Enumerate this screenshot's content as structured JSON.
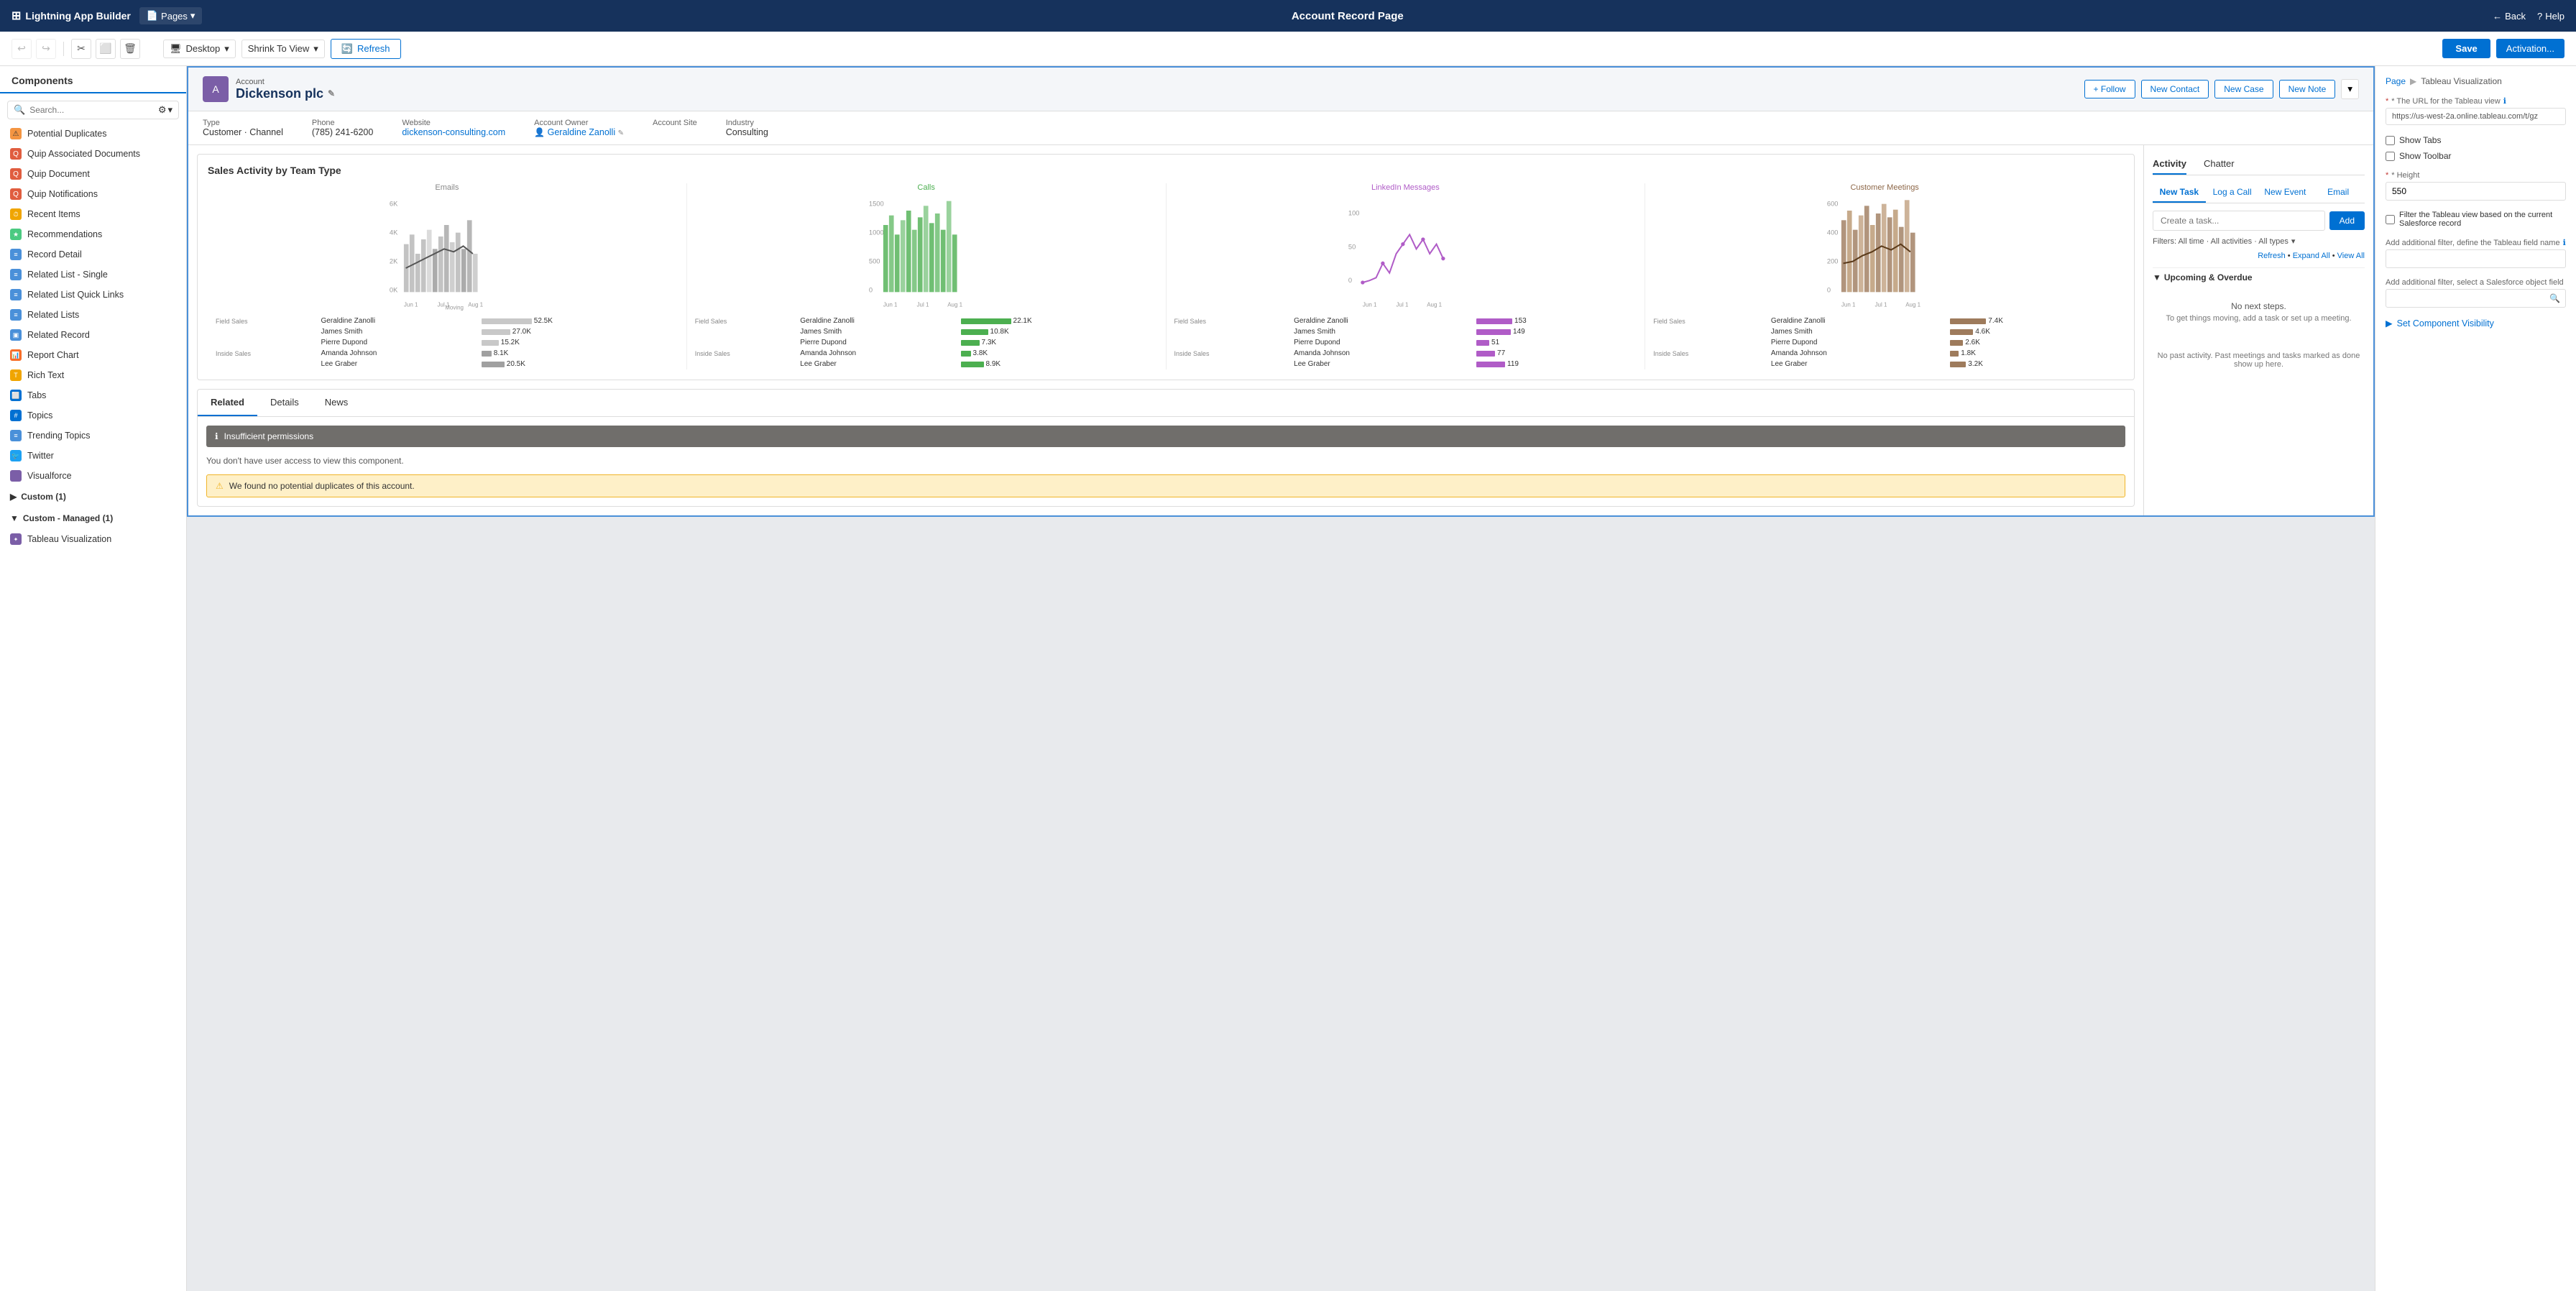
{
  "topNav": {
    "appName": "Lightning App Builder",
    "pages": "Pages",
    "title": "Account Record Page",
    "back": "Back",
    "help": "Help"
  },
  "toolbar": {
    "desktop": "Desktop",
    "shrinkToView": "Shrink To View",
    "refresh": "Refresh",
    "save": "Save",
    "activation": "Activation..."
  },
  "sidebar": {
    "title": "Components",
    "searchPlaceholder": "Search...",
    "items": [
      {
        "label": "Potential Duplicates",
        "color": "#f49542",
        "icon": "⚠"
      },
      {
        "label": "Quip Associated Documents",
        "color": "#e05d3f",
        "icon": "Q"
      },
      {
        "label": "Quip Document",
        "color": "#e05d3f",
        "icon": "Q"
      },
      {
        "label": "Quip Notifications",
        "color": "#e05d3f",
        "icon": "Q"
      },
      {
        "label": "Recent Items",
        "color": "#f0a500",
        "icon": "⏱"
      },
      {
        "label": "Recommendations",
        "color": "#4bca81",
        "icon": "★"
      },
      {
        "label": "Record Detail",
        "color": "#4a90d9",
        "icon": "≡"
      },
      {
        "label": "Related List - Single",
        "color": "#4a90d9",
        "icon": "≡"
      },
      {
        "label": "Related List Quick Links",
        "color": "#4a90d9",
        "icon": "≡"
      },
      {
        "label": "Related Lists",
        "color": "#4a90d9",
        "icon": "≡"
      },
      {
        "label": "Related Record",
        "color": "#4a90d9",
        "icon": "▣"
      },
      {
        "label": "Report Chart",
        "color": "#f86e28",
        "icon": "📊"
      },
      {
        "label": "Rich Text",
        "color": "#f0a500",
        "icon": "T"
      },
      {
        "label": "Tabs",
        "color": "#0070d2",
        "icon": "⬜"
      },
      {
        "label": "Topics",
        "color": "#0070d2",
        "icon": "#"
      },
      {
        "label": "Trending Topics",
        "color": "#4a90d9",
        "icon": "≡"
      },
      {
        "label": "Twitter",
        "color": "#1da1f2",
        "icon": "🐦"
      },
      {
        "label": "Visualforce",
        "color": "#7b5ea7",
        "icon": "</>"
      }
    ],
    "customSection": "Custom (1)",
    "customManagedSection": "Custom - Managed (1)",
    "tableauItem": "Tableau Visualization"
  },
  "record": {
    "objectType": "Account",
    "name": "Dickenson plc",
    "iconBg": "#7b5ea7",
    "fields": [
      {
        "label": "Type",
        "value": "Customer · Channel"
      },
      {
        "label": "Phone",
        "value": "(785) 241-6200"
      },
      {
        "label": "Website",
        "value": "dickenson-consulting.com",
        "isLink": true
      },
      {
        "label": "Account Owner",
        "value": "Geraldine Zanolli",
        "isLink": true
      },
      {
        "label": "Account Site",
        "value": ""
      },
      {
        "label": "Industry",
        "value": "Consulting"
      }
    ],
    "actions": {
      "follow": "+ Follow",
      "newContact": "New Contact",
      "newCase": "New Case",
      "newNote": "New Note"
    }
  },
  "chart": {
    "title": "Sales Activity by Team Type",
    "sections": [
      {
        "name": "Emails",
        "colorClass": "emails-color",
        "yLabels": [
          "6K",
          "4K",
          "2K",
          "0K"
        ],
        "xLabels": [
          "Jun 1",
          "Jul 1",
          "Aug 1"
        ],
        "rows": [
          {
            "team": "Field Sales",
            "rep": "Geraldine Zanolli",
            "value": "52.5K",
            "barW": 90
          },
          {
            "team": "",
            "rep": "James Smith",
            "value": "27.0K",
            "barW": 50
          },
          {
            "team": "",
            "rep": "Pierre Dupond",
            "value": "15.2K",
            "barW": 30
          },
          {
            "team": "Inside Sales",
            "rep": "Amanda Johnson",
            "value": "8.1K",
            "barW": 16
          },
          {
            "team": "",
            "rep": "Lee Graber",
            "value": "20.5K",
            "barW": 40
          }
        ]
      },
      {
        "name": "Calls",
        "colorClass": "calls-color",
        "yLabels": [
          "1500",
          "1000",
          "500",
          "0"
        ],
        "xLabels": [
          "Jun 1",
          "Jul 1",
          "Aug 1"
        ],
        "rows": [
          {
            "team": "Field Sales",
            "rep": "Geraldine Zanolli",
            "value": "22.1K",
            "barW": 90
          },
          {
            "team": "",
            "rep": "James Smith",
            "value": "10.8K",
            "barW": 50
          },
          {
            "team": "",
            "rep": "Pierre Dupond",
            "value": "7.3K",
            "barW": 34
          },
          {
            "team": "Inside Sales",
            "rep": "Amanda Johnson",
            "value": "3.8K",
            "barW": 18
          },
          {
            "team": "",
            "rep": "Lee Graber",
            "value": "8.9K",
            "barW": 42
          }
        ]
      },
      {
        "name": "LinkedIn Messages",
        "colorClass": "linkedin-color",
        "yLabels": [
          "100",
          "50",
          "0"
        ],
        "xLabels": [
          "Jun 1",
          "Jul 1",
          "Aug 1"
        ],
        "rows": [
          {
            "team": "Field Sales",
            "rep": "Geraldine Zanolli",
            "value": "153",
            "barW": 90
          },
          {
            "team": "",
            "rep": "James Smith",
            "value": "149",
            "barW": 88
          },
          {
            "team": "",
            "rep": "Pierre Dupond",
            "value": "51",
            "barW": 32
          },
          {
            "team": "Inside Sales",
            "rep": "Amanda Johnson",
            "value": "77",
            "barW": 50
          },
          {
            "team": "",
            "rep": "Lee Graber",
            "value": "119",
            "barW": 74
          }
        ]
      },
      {
        "name": "Customer Meetings",
        "colorClass": "meetings-color",
        "yLabels": [
          "600",
          "400",
          "200",
          "0"
        ],
        "xLabels": [
          "Jun 1",
          "Jul 1",
          "Aug 1"
        ],
        "rows": [
          {
            "team": "Field Sales",
            "rep": "Geraldine Zanolli",
            "value": "7.4K",
            "barW": 90
          },
          {
            "team": "",
            "rep": "James Smith",
            "value": "4.6K",
            "barW": 56
          },
          {
            "team": "",
            "rep": "Pierre Dupond",
            "value": "2.6K",
            "barW": 32
          },
          {
            "team": "Inside Sales",
            "rep": "Amanda Johnson",
            "value": "1.8K",
            "barW": 22
          },
          {
            "team": "",
            "rep": "Lee Graber",
            "value": "3.2K",
            "barW": 40
          }
        ]
      }
    ]
  },
  "tabs": {
    "items": [
      "Related",
      "Details",
      "News"
    ],
    "active": "Related",
    "permissionWarning": "Insufficient permissions",
    "permissionDetail": "You don't have user access to view this component.",
    "duplicateMsg": "We found no potential duplicates of this account."
  },
  "activity": {
    "tabs": [
      "Activity",
      "Chatter"
    ],
    "activeTab": "Activity",
    "actions": [
      "New Task",
      "Log a Call",
      "New Event",
      "Email"
    ],
    "activeAction": "New Task",
    "taskPlaceholder": "Create a task...",
    "addBtn": "Add",
    "filters": "Filters: All time · All activities · All types",
    "filterIcon": "▾",
    "refreshLink": "Refresh",
    "expandAll": "Expand All",
    "viewAll": "View All",
    "upcomingSection": "Upcoming & Overdue",
    "noNextSteps": "No next steps.",
    "noNextDetail": "To get things moving, add a task or set up a meeting.",
    "noPastActivity": "No past activity. Past meetings and tasks marked as done show up here."
  },
  "rightPanel": {
    "breadcrumb": [
      "Page",
      "Tableau Visualization"
    ],
    "urlLabel": "* The URL for the Tableau view",
    "urlValue": "https://us-west-2a.online.tableau.com/t/gz",
    "showTabs": "Show Tabs",
    "showToolbar": "Show Toolbar",
    "heightLabel": "* Height",
    "heightValue": "550",
    "filterLabel": "Filter the Tableau view based on the current Salesforce record",
    "additionalFilterLabel": "Add additional filter, define the Tableau field name",
    "additionalFilterPlaceholder": "",
    "objectFieldLabel": "Add additional filter, select a Salesforce object field",
    "setVisibility": "Set Component Visibility"
  }
}
